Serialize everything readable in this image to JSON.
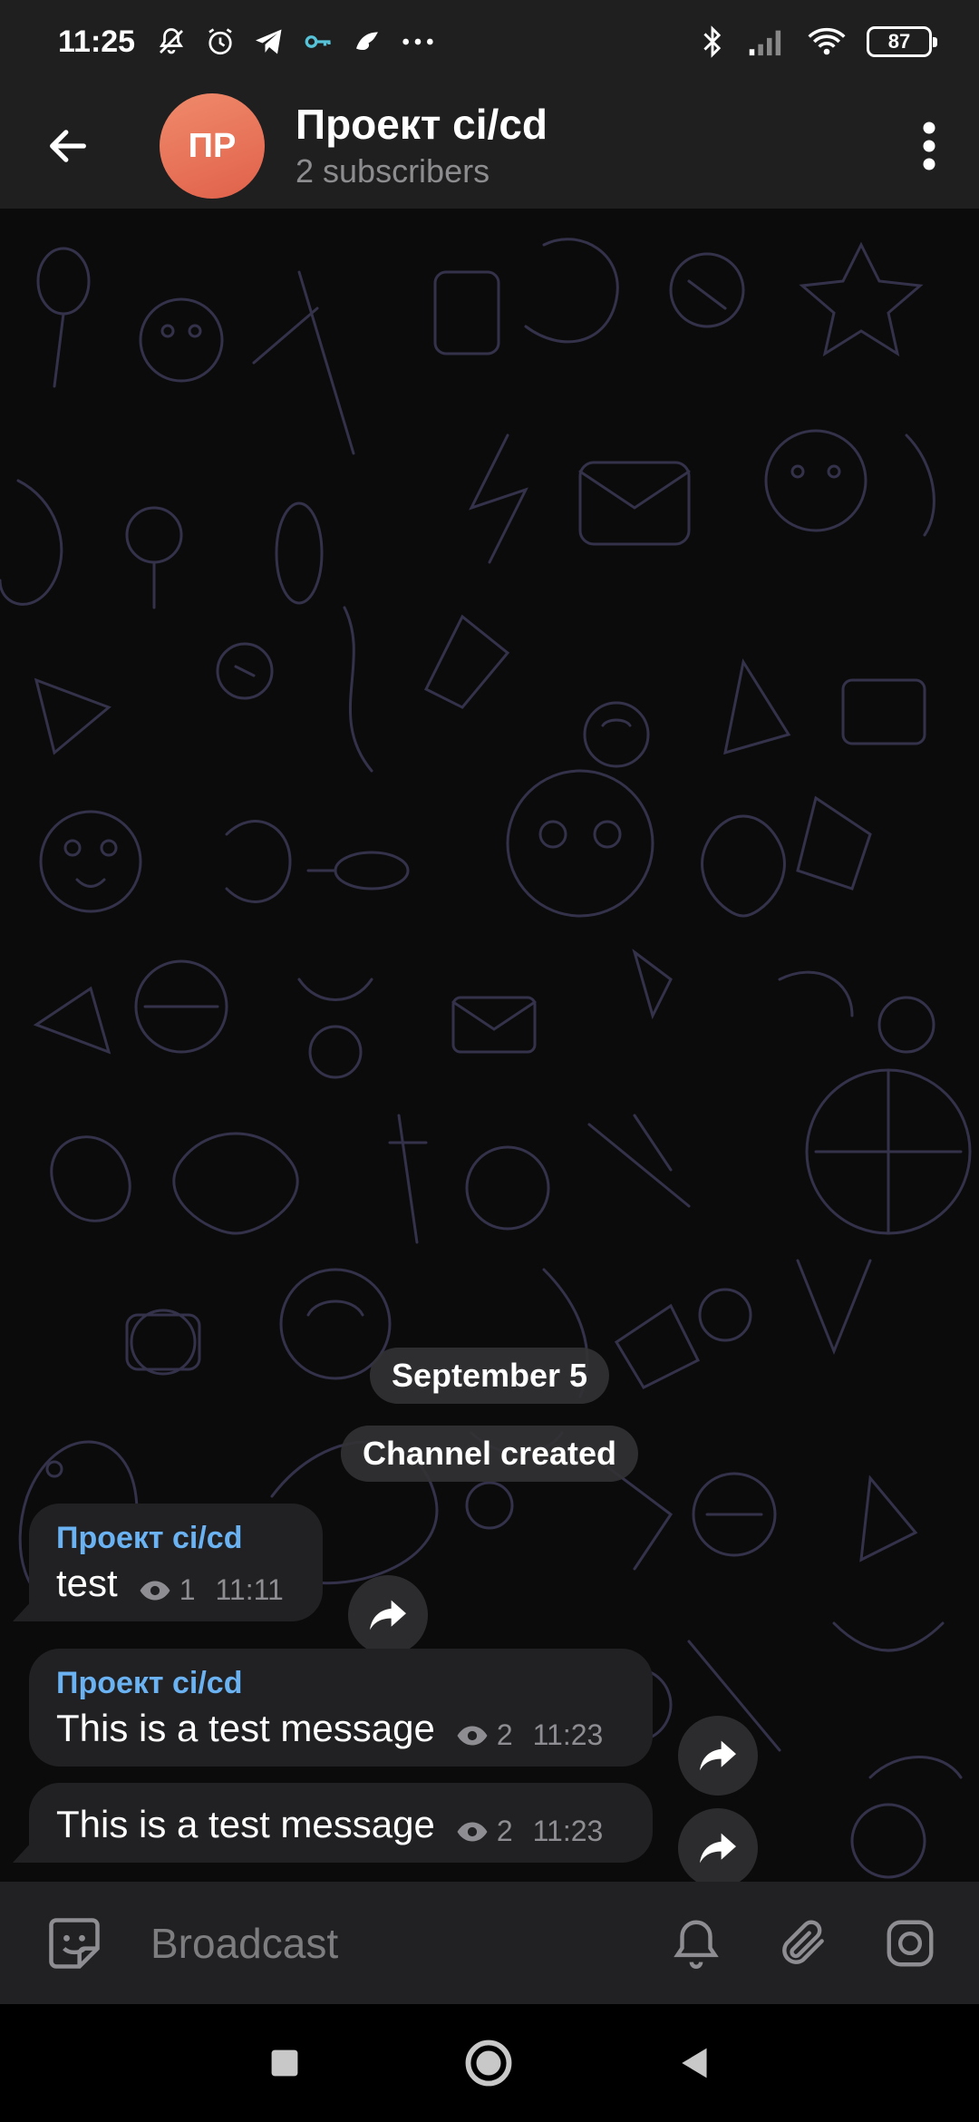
{
  "status_bar": {
    "time": "11:25",
    "battery": "87",
    "left_icons": [
      "mute-icon",
      "alarm-icon",
      "telegram-icon",
      "key-icon",
      "bird-icon",
      "more-dots-icon"
    ],
    "right_icons": [
      "bluetooth-icon",
      "signal-icon",
      "wifi-icon",
      "battery-icon"
    ]
  },
  "header": {
    "avatar_initials": "ПР",
    "title": "Проект ci/cd",
    "subtitle": "2 subscribers",
    "avatar_color": "#e46e55"
  },
  "chat": {
    "date_label": "September 5",
    "service_message": "Channel created",
    "messages": [
      {
        "sender": "Проект ci/cd",
        "text": "test",
        "views": "1",
        "time": "11:11"
      },
      {
        "sender": "Проект ci/cd",
        "text": "This is a test message",
        "views": "2",
        "time": "11:23"
      },
      {
        "sender": "",
        "text": "This is a test message",
        "views": "2",
        "time": "11:23"
      }
    ]
  },
  "composer": {
    "placeholder": "Broadcast"
  },
  "colors": {
    "accent": "#6ab2f2",
    "bubble": "#212123",
    "header": "#1f1f20"
  }
}
